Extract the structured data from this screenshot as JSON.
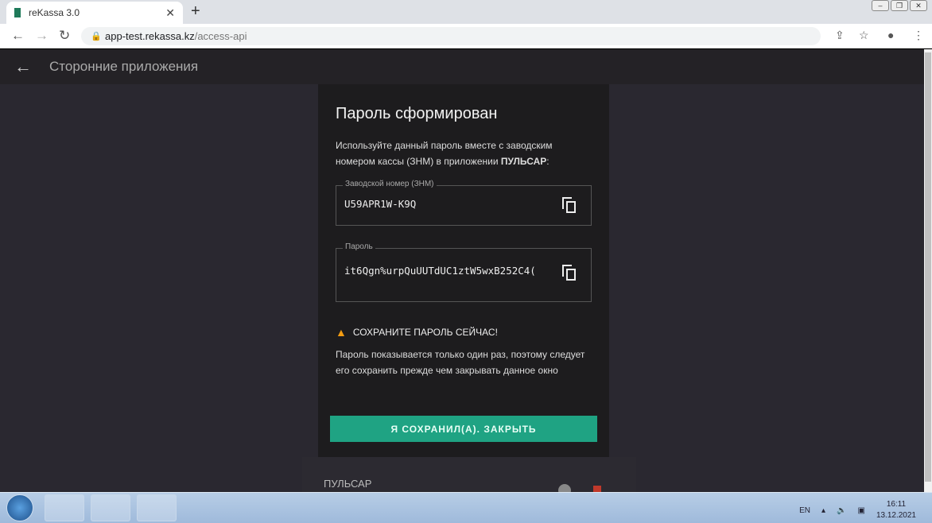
{
  "browser": {
    "tab_title": "reKassa 3.0",
    "url_host": "app-test.rekassa.kz",
    "url_path": "/access-api"
  },
  "app": {
    "title": "Сторонние приложения"
  },
  "dialog": {
    "title": "Пароль сформирован",
    "intro": "Используйте данный пароль вместе с заводским номером кассы (ЗНМ) в приложении ",
    "intro_app": "ПУЛЬСАР",
    "intro_end": ":",
    "serial_label": "Заводской номер (ЗНМ)",
    "serial_value": "U59APR1W-K9Q",
    "password_label": "Пароль",
    "password_value": "it6Qgn%urpQuUUTdUC1ztW5wxB252C4(",
    "warning": "СОХРАНИТЕ ПАРОЛЬ СЕЙЧАС!",
    "note": "Пароль показывается только один раз, поэтому следует его сохранить прежде чем закрывать данное окно",
    "close_button": "Я СОХРАНИЛ(А). ЗАКРЫТЬ"
  },
  "background_card": {
    "title": "ПУЛЬСАР"
  },
  "taskbar": {
    "lang": "EN",
    "time": "16:11",
    "date": "13.12.2021"
  },
  "colors": {
    "accent": "#1fa383",
    "warning": "#f39c12"
  }
}
